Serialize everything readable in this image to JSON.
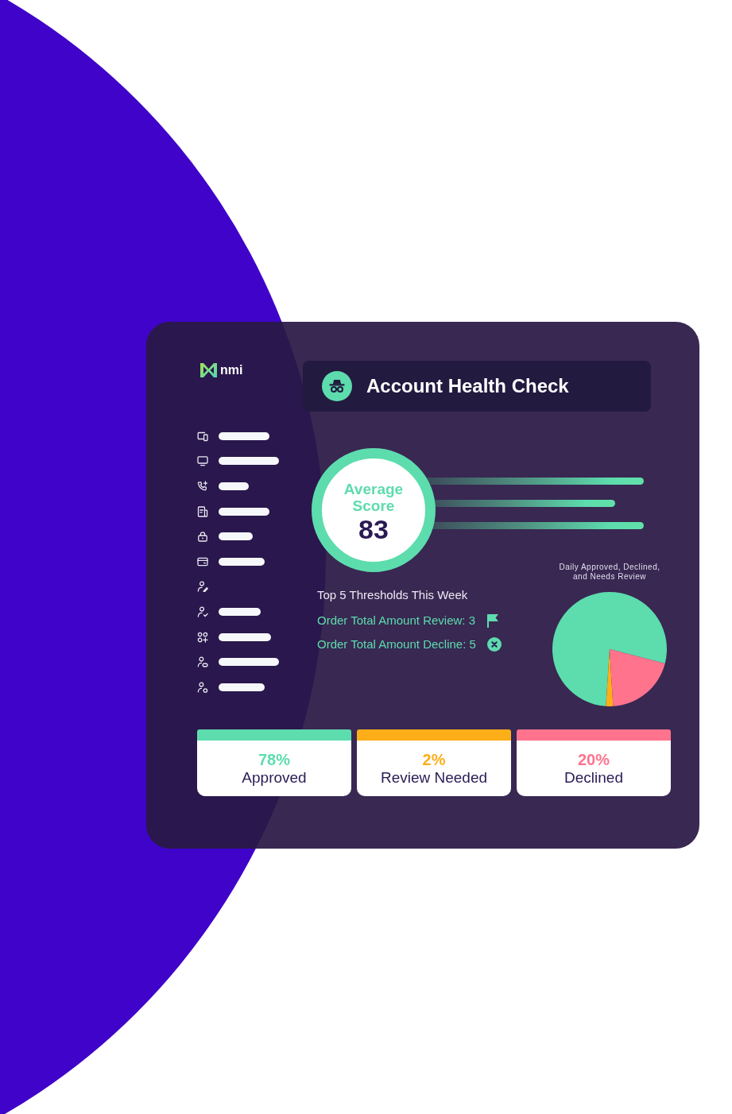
{
  "logo": {
    "text": "nmi"
  },
  "header": {
    "title": "Account Health Check"
  },
  "score": {
    "label": "Average Score",
    "value": "83"
  },
  "thresholds": {
    "title": "Top 5 Thresholds This Week",
    "items": [
      {
        "kind": "review",
        "text": "Order Total Amount Review: 3"
      },
      {
        "kind": "decline",
        "text": "Order Total Amount Decline: 5"
      }
    ]
  },
  "pie": {
    "chart_data": {
      "type": "pie",
      "title": "Daily Approved, Declined, and Needs Review",
      "values": [
        78,
        2,
        20
      ]
    }
  },
  "stats": [
    {
      "value": "78%",
      "label": "Approved",
      "color": "#5ddcad"
    },
    {
      "value": "2%",
      "label": "Review Needed",
      "color": "#fdae19"
    },
    {
      "value": "20%",
      "label": "Declined",
      "color": "#ff738d"
    }
  ]
}
